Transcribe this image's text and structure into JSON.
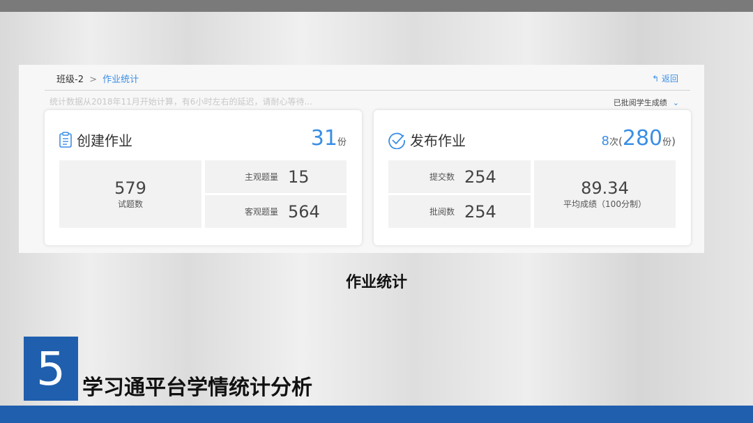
{
  "breadcrumb": {
    "class_name": "班级-2",
    "separator": ">",
    "current": "作业统计"
  },
  "back_label": "返回",
  "notice": "统计数据从2018年11月开始计算，有6小时左右的延迟，请耐心等待...",
  "filter_label": "已批阅学生成绩",
  "create_card": {
    "title": "创建作业",
    "count": "31",
    "count_unit": "份",
    "total_questions": "579",
    "total_questions_label": "试题数",
    "subjective_label": "主观题量",
    "subjective_value": "15",
    "objective_label": "客观题量",
    "objective_value": "564"
  },
  "publish_card": {
    "title": "发布作业",
    "times": "8",
    "times_unit": "次",
    "paren_open": "(",
    "copies": "280",
    "copies_unit": "份",
    "paren_close": ")",
    "submitted_label": "提交数",
    "submitted_value": "254",
    "reviewed_label": "批阅数",
    "reviewed_value": "254",
    "avg_score": "89.34",
    "avg_score_label": "平均成绩（100分制）"
  },
  "caption": "作业统计",
  "section_number": "5",
  "section_title": "学习通平台学情统计分析",
  "colors": {
    "accent_blue": "#3a8ee6",
    "brand_blue": "#1f5fae"
  }
}
